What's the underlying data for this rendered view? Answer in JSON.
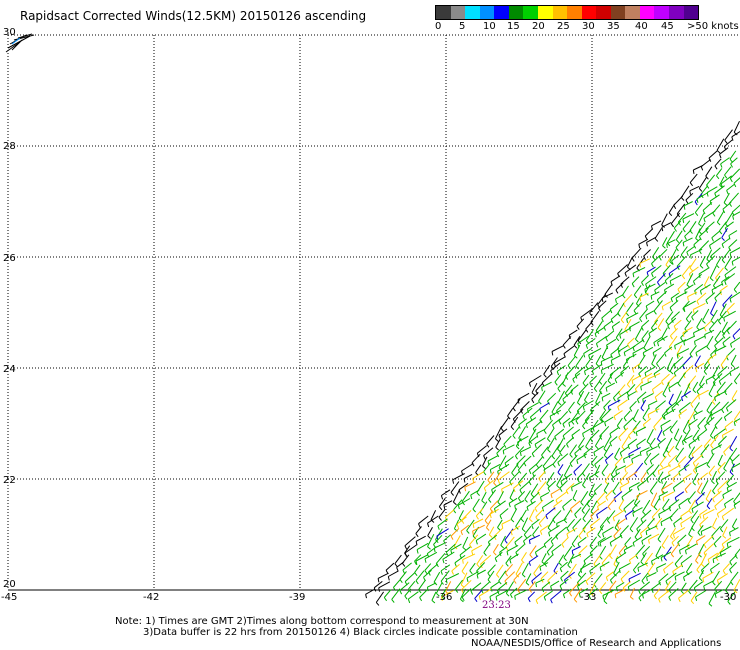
{
  "title": "Rapidsact Corrected Winds(12.5KM) 20150126 ascending",
  "legend": {
    "colors": [
      "#3a3a3a",
      "#8a8a8a",
      "#00e0ff",
      "#0090ff",
      "#0000ff",
      "#008a00",
      "#00d000",
      "#ffff00",
      "#ffc000",
      "#ff8000",
      "#ff0000",
      "#d00000",
      "#804020",
      "#c08060",
      "#ff00ff",
      "#c000ff",
      "#8000c0",
      "#500090"
    ],
    "ticks": [
      "0",
      "5",
      "10",
      "15",
      "20",
      "25",
      "30",
      "35",
      "40",
      "45",
      ">50 knots"
    ]
  },
  "axes": {
    "lon_labels": [
      "-45",
      "-42",
      "-39",
      "-36",
      "-33",
      "-30"
    ],
    "lat_labels": [
      "30",
      "28",
      "26",
      "24",
      "22",
      "20"
    ],
    "lon_range": [
      -45,
      -30
    ],
    "lat_range": [
      20,
      30
    ]
  },
  "time_label": "23:23",
  "notes": [
    "Note: 1) Times are GMT 2)Times along bottom correspond to measurement at 30N",
    "3)Data buffer is 22 hrs from 20150126 4) Black circles indicate possible contamination",
    "NOAA/NESDIS/Office of Research and Applications"
  ],
  "swath": {
    "dominant_color": "#00b000",
    "edge_color": "#000000",
    "secondary_colors": [
      "#ffd000",
      "#ff9900",
      "#0000cc"
    ],
    "direction_deg": 225
  }
}
